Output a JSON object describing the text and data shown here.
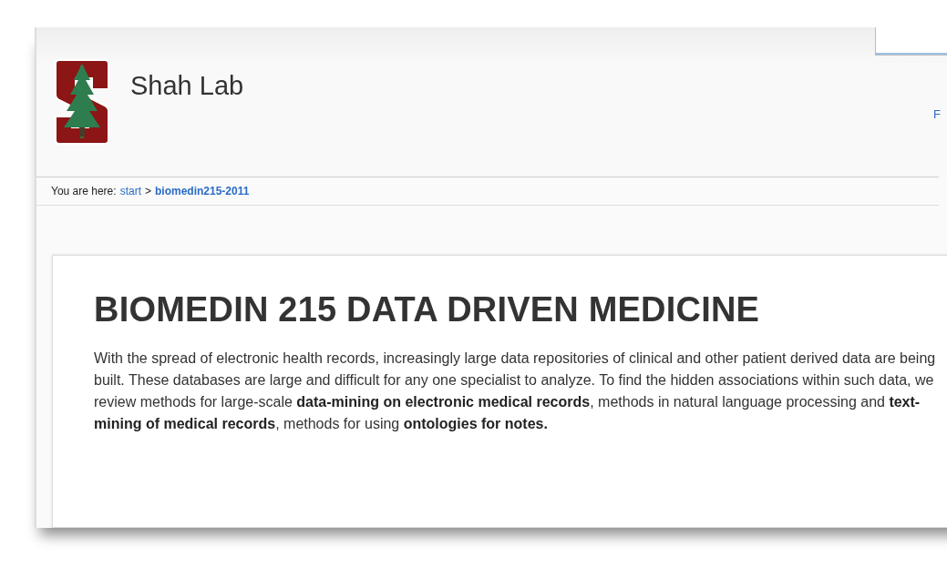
{
  "header": {
    "site_title": "Shah Lab",
    "edge_link": "F"
  },
  "breadcrumb": {
    "label": "You are here:",
    "items": [
      {
        "text": "start",
        "current": false
      },
      {
        "text": "biomedin215-2011",
        "current": true
      }
    ],
    "separator": ">"
  },
  "content": {
    "heading": "BIOMEDIN 215 DATA DRIVEN MEDICINE",
    "paragraph": "With the spread of electronic health records, increasingly large data repositories of clinical and other patient derived data are being built. These databases are large and difficult for any one specialist to analyze. To find the hidden associations within such data, we review methods for large-scale **data-mining on electronic medical records**, methods in natural language processing and **text-mining of medical records**, methods for using **ontologies for notes.**"
  }
}
